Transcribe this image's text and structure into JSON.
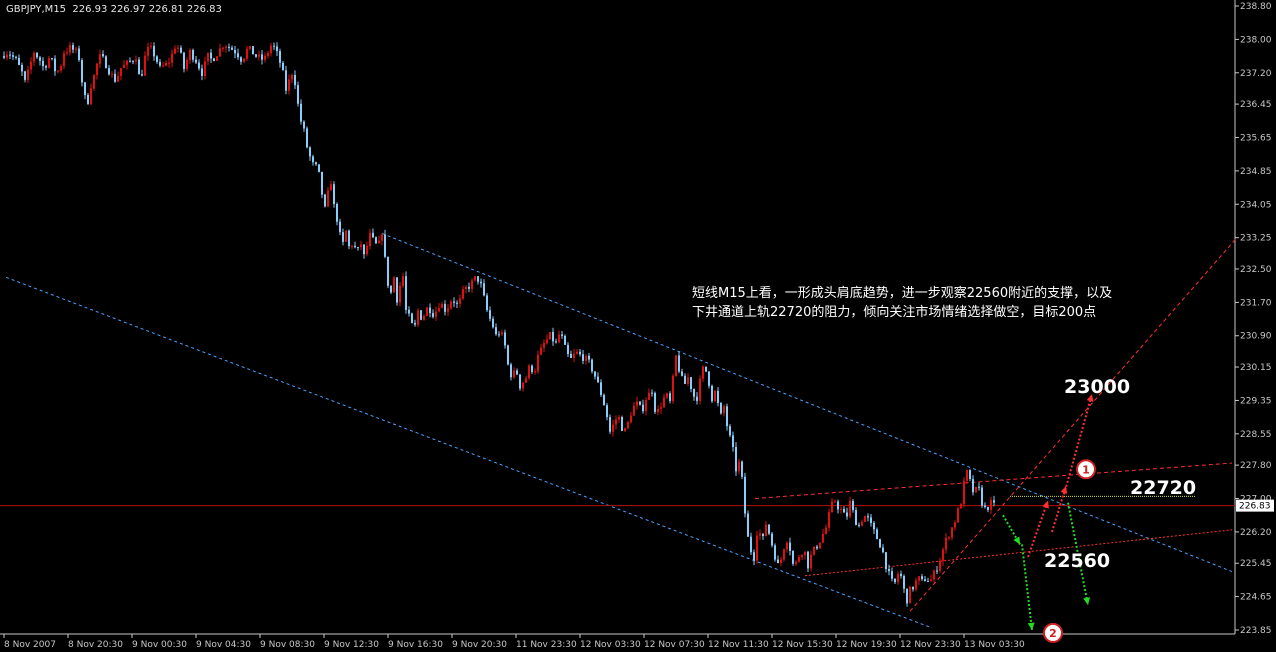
{
  "symbol_header": {
    "symbol": "GBPJPY,M15",
    "ohlc": "226.93 226.97 226.81 226.83"
  },
  "comment": {
    "line1": "短线M15上看，一形成头肩底趋势，进一步观察22560附近的支撑，以及",
    "line2": "下井通道上轨22720的阻力，倾向关注市场情绪选择做空，目标200点"
  },
  "labels": {
    "target_up": "23000",
    "resistance": "22720",
    "support": "22560",
    "marker_1": "1",
    "marker_2": "2"
  },
  "colors": {
    "bull_candle": "#e01010",
    "bear_candle": "#87cefa",
    "channel": "#4aa3ff",
    "red_dashed": "#ff3030",
    "green_dotted": "#22dd22",
    "current_price_line": "#b01010",
    "yellow_line": "#dcdc30",
    "axis": "#c8c8c8"
  },
  "chart_data": {
    "type": "candlestick",
    "title": "",
    "current_price": 226.83,
    "ylim": [
      223.85,
      238.8
    ],
    "y_ticks": [
      238.8,
      238.0,
      237.2,
      236.45,
      235.65,
      234.85,
      234.05,
      233.25,
      232.5,
      231.7,
      230.9,
      230.15,
      229.35,
      228.55,
      227.8,
      227.0,
      226.2,
      225.45,
      224.65,
      223.85
    ],
    "x_tick_labels": [
      "8 Nov 2007",
      "8 Nov 20:30",
      "9 Nov 00:30",
      "9 Nov 04:30",
      "9 Nov 08:30",
      "9 Nov 12:30",
      "9 Nov 16:30",
      "9 Nov 20:30",
      "11 Nov 23:30",
      "12 Nov 03:30",
      "12 Nov 07:30",
      "12 Nov 11:30",
      "12 Nov 15:30",
      "12 Nov 19:30",
      "12 Nov 23:30",
      "13 Nov 03:30"
    ],
    "close_path": [
      [
        0,
        237.6
      ],
      [
        8,
        237.7
      ],
      [
        16,
        237.5
      ],
      [
        22,
        237.2
      ],
      [
        26,
        236.9
      ],
      [
        28,
        237.2
      ],
      [
        34,
        237.7
      ],
      [
        40,
        237.5
      ],
      [
        44,
        237.3
      ],
      [
        50,
        237.6
      ],
      [
        53,
        237.4
      ],
      [
        56,
        237.2
      ],
      [
        60,
        237.3
      ],
      [
        62,
        237.5
      ],
      [
        64,
        237.7
      ],
      [
        68,
        237.75
      ],
      [
        70,
        237.8
      ],
      [
        76,
        237.7
      ],
      [
        80,
        237.5
      ],
      [
        82,
        237.0
      ],
      [
        85,
        236.6
      ],
      [
        89,
        236.5
      ],
      [
        91,
        236.9
      ],
      [
        95,
        237.2
      ],
      [
        99,
        237.6
      ],
      [
        104,
        237.5
      ],
      [
        110,
        237.2
      ],
      [
        116,
        237.0
      ],
      [
        120,
        237.3
      ],
      [
        126,
        237.4
      ],
      [
        132,
        237.5
      ],
      [
        136,
        237.6
      ],
      [
        138,
        237.1
      ],
      [
        142,
        237.2
      ],
      [
        146,
        237.7
      ],
      [
        150,
        237.8
      ],
      [
        155,
        237.6
      ],
      [
        160,
        237.3
      ],
      [
        166,
        237.4
      ],
      [
        170,
        237.5
      ],
      [
        176,
        237.9
      ],
      [
        180,
        237.7
      ],
      [
        184,
        237.3
      ],
      [
        190,
        237.7
      ],
      [
        196,
        237.5
      ],
      [
        202,
        237.2
      ],
      [
        208,
        237.6
      ],
      [
        212,
        237.5
      ],
      [
        218,
        237.7
      ],
      [
        224,
        237.9
      ],
      [
        230,
        237.8
      ],
      [
        236,
        237.7
      ],
      [
        242,
        237.5
      ],
      [
        248,
        237.8
      ],
      [
        256,
        237.6
      ],
      [
        264,
        237.5
      ],
      [
        272,
        237.9
      ],
      [
        278,
        237.6
      ],
      [
        282,
        237.3
      ],
      [
        286,
        236.8
      ],
      [
        292,
        237.2
      ],
      [
        296,
        236.9
      ],
      [
        299,
        236.2
      ],
      [
        304,
        235.8
      ],
      [
        308,
        235.3
      ],
      [
        313,
        235.0
      ],
      [
        318,
        234.9
      ],
      [
        322,
        234.3
      ],
      [
        326,
        233.8
      ],
      [
        330,
        234.8
      ],
      [
        334,
        234.0
      ],
      [
        338,
        233.6
      ],
      [
        342,
        233.0
      ],
      [
        346,
        233.4
      ],
      [
        350,
        232.9
      ],
      [
        354,
        233.3
      ],
      [
        356,
        232.7
      ],
      [
        360,
        233.2
      ],
      [
        364,
        232.8
      ],
      [
        370,
        233.3
      ],
      [
        378,
        233.0
      ],
      [
        382,
        233.4
      ],
      [
        386,
        232.5
      ],
      [
        390,
        231.8
      ],
      [
        394,
        232.3
      ],
      [
        398,
        231.6
      ],
      [
        402,
        232.6
      ],
      [
        406,
        231.5
      ],
      [
        410,
        231.3
      ],
      [
        414,
        231.0
      ],
      [
        418,
        231.5
      ],
      [
        422,
        231.3
      ],
      [
        428,
        231.6
      ],
      [
        434,
        231.4
      ],
      [
        440,
        231.7
      ],
      [
        446,
        231.5
      ],
      [
        452,
        231.8
      ],
      [
        458,
        231.6
      ],
      [
        464,
        232.0
      ],
      [
        470,
        232.1
      ],
      [
        476,
        232.3
      ],
      [
        480,
        232.2
      ],
      [
        484,
        231.8
      ],
      [
        488,
        231.4
      ],
      [
        492,
        231.2
      ],
      [
        496,
        230.9
      ],
      [
        500,
        231.0
      ],
      [
        504,
        230.8
      ],
      [
        508,
        230.2
      ],
      [
        512,
        229.9
      ],
      [
        516,
        230.1
      ],
      [
        520,
        229.7
      ],
      [
        526,
        229.9
      ],
      [
        530,
        230.2
      ],
      [
        534,
        230.0
      ],
      [
        538,
        230.4
      ],
      [
        544,
        230.7
      ],
      [
        550,
        230.9
      ],
      [
        556,
        230.7
      ],
      [
        560,
        231.0
      ],
      [
        565,
        230.6
      ],
      [
        570,
        230.3
      ],
      [
        576,
        230.5
      ],
      [
        582,
        230.4
      ],
      [
        588,
        230.3
      ],
      [
        594,
        230.0
      ],
      [
        600,
        229.6
      ],
      [
        606,
        229.1
      ],
      [
        610,
        228.6
      ],
      [
        614,
        228.8
      ],
      [
        618,
        229.0
      ],
      [
        622,
        228.7
      ],
      [
        626,
        228.6
      ],
      [
        630,
        229.0
      ],
      [
        636,
        229.3
      ],
      [
        642,
        229.1
      ],
      [
        646,
        229.4
      ],
      [
        652,
        229.6
      ],
      [
        656,
        229.0
      ],
      [
        660,
        229.2
      ],
      [
        666,
        229.5
      ],
      [
        670,
        229.3
      ],
      [
        676,
        230.4
      ],
      [
        680,
        230.0
      ],
      [
        684,
        229.7
      ],
      [
        688,
        229.9
      ],
      [
        692,
        229.6
      ],
      [
        696,
        229.3
      ],
      [
        700,
        229.8
      ],
      [
        704,
        230.2
      ],
      [
        708,
        229.9
      ],
      [
        712,
        229.4
      ],
      [
        716,
        229.6
      ],
      [
        720,
        228.9
      ],
      [
        724,
        229.2
      ],
      [
        728,
        228.6
      ],
      [
        732,
        228.3
      ],
      [
        736,
        227.7
      ],
      [
        740,
        227.9
      ],
      [
        744,
        227.0
      ],
      [
        746,
        226.3
      ],
      [
        750,
        225.8
      ],
      [
        754,
        225.6
      ],
      [
        758,
        226.4
      ],
      [
        762,
        225.9
      ],
      [
        766,
        226.4
      ],
      [
        770,
        226.1
      ],
      [
        774,
        225.7
      ],
      [
        778,
        225.4
      ],
      [
        782,
        225.6
      ],
      [
        786,
        226.1
      ],
      [
        790,
        225.8
      ],
      [
        794,
        225.3
      ],
      [
        798,
        225.6
      ],
      [
        804,
        225.8
      ],
      [
        808,
        225.4
      ],
      [
        812,
        225.7
      ],
      [
        818,
        225.9
      ],
      [
        822,
        226.1
      ],
      [
        826,
        226.3
      ],
      [
        830,
        226.7
      ],
      [
        834,
        227.0
      ],
      [
        838,
        226.8
      ],
      [
        842,
        226.7
      ],
      [
        846,
        226.5
      ],
      [
        850,
        226.9
      ],
      [
        854,
        226.6
      ],
      [
        858,
        226.3
      ],
      [
        862,
        226.5
      ],
      [
        866,
        226.6
      ],
      [
        870,
        226.4
      ],
      [
        874,
        226.2
      ],
      [
        878,
        226.0
      ],
      [
        882,
        225.8
      ],
      [
        886,
        225.4
      ],
      [
        890,
        225.1
      ],
      [
        894,
        224.9
      ],
      [
        898,
        225.2
      ],
      [
        902,
        225.1
      ],
      [
        906,
        224.5
      ],
      [
        910,
        224.8
      ],
      [
        914,
        224.9
      ],
      [
        918,
        225.1
      ],
      [
        922,
        225.0
      ],
      [
        926,
        225.1
      ],
      [
        930,
        225.0
      ],
      [
        934,
        225.2
      ],
      [
        938,
        225.4
      ],
      [
        942,
        225.7
      ],
      [
        946,
        226.0
      ],
      [
        950,
        226.2
      ],
      [
        954,
        226.4
      ],
      [
        958,
        226.7
      ],
      [
        962,
        227.0
      ],
      [
        966,
        227.7
      ],
      [
        970,
        227.4
      ],
      [
        974,
        227.1
      ],
      [
        978,
        227.3
      ],
      [
        982,
        226.9
      ],
      [
        986,
        226.7
      ],
      [
        990,
        226.9
      ],
      [
        994,
        226.83
      ]
    ],
    "channel_upper": [
      [
        382,
        233.35
      ],
      [
        1232,
        225.25
      ]
    ],
    "channel_lower": [
      [
        6,
        232.3
      ],
      [
        932,
        223.9
      ]
    ],
    "red_channel_upper": [
      [
        755,
        227.0
      ],
      [
        1232,
        227.85
      ]
    ],
    "red_channel_lower": [
      [
        805,
        225.15
      ],
      [
        1232,
        226.25
      ]
    ],
    "red_trend_up": [
      [
        910,
        224.3
      ],
      [
        1237,
        233.25
      ]
    ],
    "current_price_line_y": 226.83,
    "yellow_line": {
      "x_range": [
        1010,
        1195
      ],
      "y": 227.05
    },
    "red_arrows": [
      [
        [
          1028,
          225.6
        ],
        [
          1048,
          226.95
        ]
      ],
      [
        [
          1052,
          226.2
        ],
        [
          1066,
          227.3
        ]
      ],
      [
        [
          1064,
          227.1
        ],
        [
          1092,
          229.5
        ]
      ]
    ],
    "green_arrows": [
      [
        [
          1003,
          226.6
        ],
        [
          1020,
          225.9
        ]
      ],
      [
        [
          1022,
          225.9
        ],
        [
          1032,
          223.85
        ]
      ],
      [
        [
          1068,
          226.9
        ],
        [
          1088,
          224.45
        ]
      ]
    ],
    "markers": [
      {
        "label": "1",
        "x": 1086,
        "y": 227.7
      },
      {
        "label": "2",
        "x": 1053,
        "y": 223.78
      }
    ]
  }
}
